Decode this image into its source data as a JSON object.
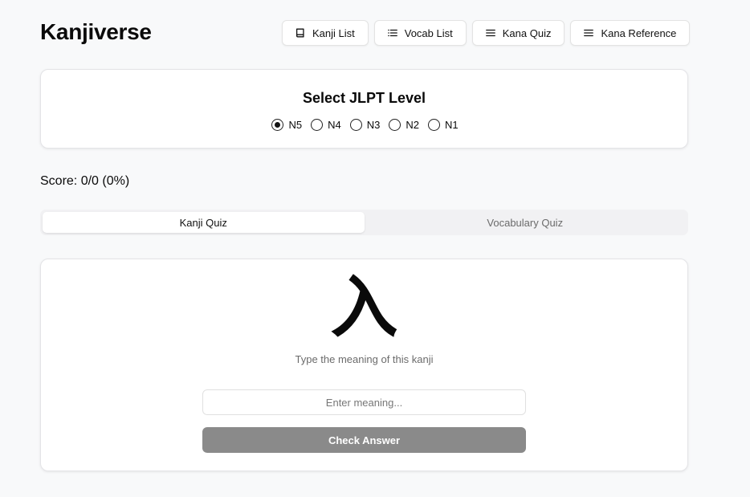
{
  "app": {
    "title": "Kanjiverse"
  },
  "nav": [
    {
      "label": "Kanji List",
      "icon": "book-icon"
    },
    {
      "label": "Vocab List",
      "icon": "list-icon"
    },
    {
      "label": "Kana Quiz",
      "icon": "menu-icon"
    },
    {
      "label": "Kana Reference",
      "icon": "menu-icon"
    }
  ],
  "level_select": {
    "title": "Select JLPT Level",
    "options": [
      "N5",
      "N4",
      "N3",
      "N2",
      "N1"
    ],
    "selected": "N5"
  },
  "score": {
    "text": "Score: 0/0 (0%)"
  },
  "tabs": [
    {
      "label": "Kanji Quiz",
      "active": true
    },
    {
      "label": "Vocabulary Quiz",
      "active": false
    }
  ],
  "quiz": {
    "kanji": "入",
    "hint": "Type the meaning of this kanji",
    "input_value": "",
    "input_placeholder": "Enter meaning...",
    "check_label": "Check Answer"
  },
  "colors": {
    "check_button": "#8a8a8a",
    "background": "#f8f9fa"
  }
}
